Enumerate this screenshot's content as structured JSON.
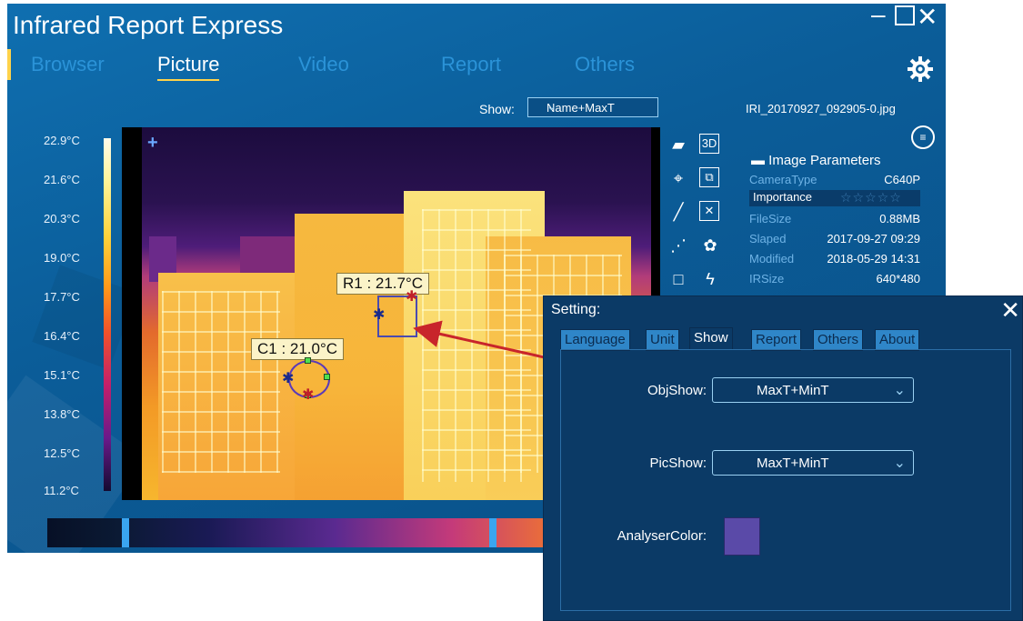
{
  "app": {
    "title": "Infrared Report Express",
    "tabs": [
      "Browser",
      "Picture",
      "Video",
      "Report",
      "Others"
    ],
    "active_tab": "Picture",
    "show_label": "Show:",
    "show_value": "Name+MaxT",
    "filename": "IRI_20170927_092905-0.jpg"
  },
  "scale": {
    "labels": [
      "22.9°C",
      "21.6°C",
      "20.3°C",
      "19.0°C",
      "17.7°C",
      "16.4°C",
      "15.1°C",
      "13.8°C",
      "12.5°C",
      "11.2°C"
    ]
  },
  "measurements": {
    "r1": "R1 : 21.7°C",
    "c1": "C1 : 21.0°C"
  },
  "tools": [
    "folder-icon",
    "3d-view-icon",
    "crosshair-icon",
    "region-copy-icon",
    "line-tool-icon",
    "delete-icon",
    "polyline-tool-icon",
    "palette-icon",
    "rectangle-tool-icon",
    "flash-icon"
  ],
  "tool_glyphs": {
    "3d": "3D"
  },
  "params": {
    "title": "Image Parameters",
    "rows": [
      {
        "key": "CameraType",
        "value": "C640P"
      },
      {
        "key": "Importance",
        "value": "☆☆☆☆☆"
      },
      {
        "key": "FileSize",
        "value": "0.88MB"
      },
      {
        "key": "Slaped",
        "value": "2017-09-27 09:29"
      },
      {
        "key": "Modified",
        "value": "2018-05-29 14:31"
      },
      {
        "key": "IRSize",
        "value": "640*480"
      }
    ]
  },
  "dialog": {
    "title": "Setting:",
    "tabs": [
      "Language",
      "Unit",
      "Show",
      "Report",
      "Others",
      "About"
    ],
    "active_tab": "Show",
    "objshow_label": "ObjShow:",
    "objshow_value": "MaxT+MinT",
    "picshow_label": "PicShow:",
    "picshow_value": "MaxT+MinT",
    "analyser_label": "AnalyserColor:",
    "analyser_color": "#5a4aa8"
  },
  "colors": {
    "window_bg": "#0b5d99",
    "accent": "#ffd24a",
    "arrow": "#c8252b"
  }
}
